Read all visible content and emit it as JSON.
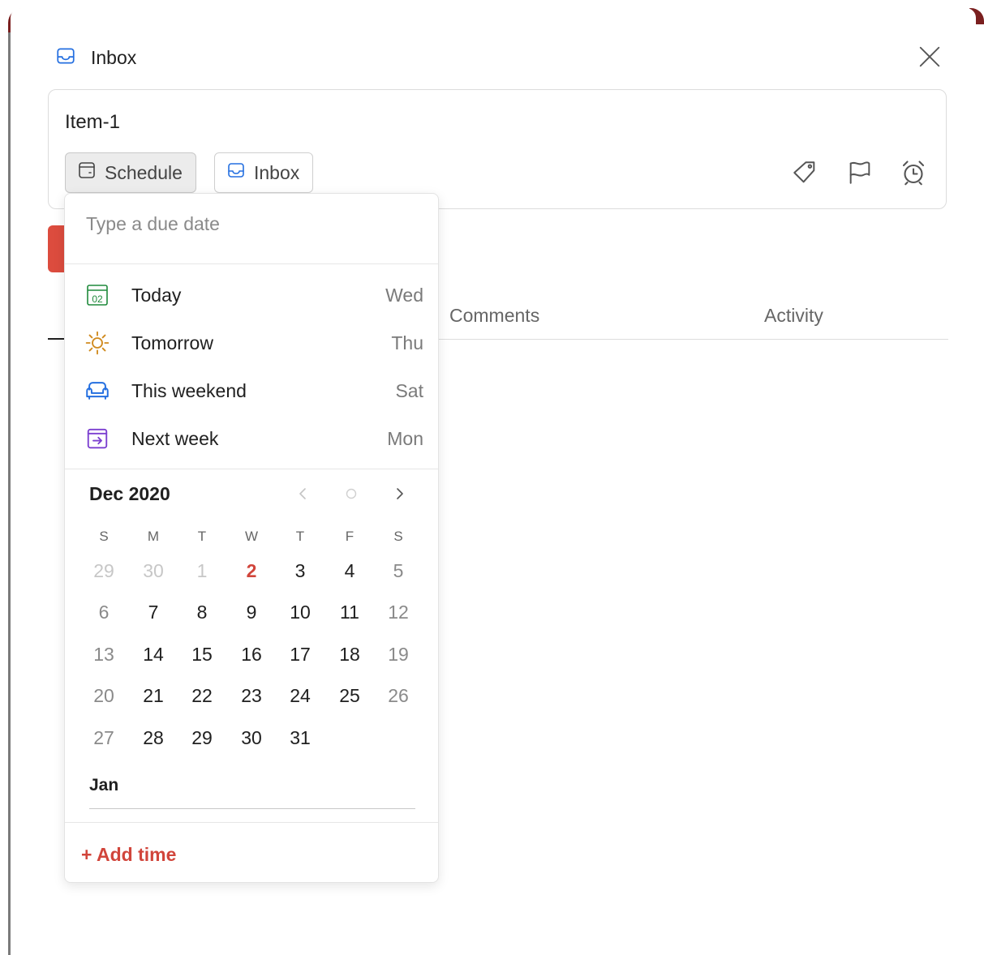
{
  "header": {
    "project": "Inbox"
  },
  "task": {
    "title": "Item-1",
    "schedule_label": "Schedule",
    "project_label": "Inbox"
  },
  "tabs": [
    {
      "label": "Comments"
    },
    {
      "label": "Activity"
    }
  ],
  "due_picker": {
    "placeholder": "Type a due date",
    "quick_options": [
      {
        "label": "Today",
        "day": "Wed",
        "icon": "calendar-today-icon",
        "icon_text": "02",
        "color": "#1f8a3b"
      },
      {
        "label": "Tomorrow",
        "day": "Thu",
        "icon": "sun-icon",
        "color": "#d08a1e"
      },
      {
        "label": "This weekend",
        "day": "Sat",
        "icon": "sofa-icon",
        "color": "#246fe0"
      },
      {
        "label": "Next week",
        "day": "Mon",
        "icon": "arrow-box-icon",
        "color": "#7b3fd0"
      }
    ],
    "calendar": {
      "month_label": "Dec 2020",
      "weekdays": [
        "S",
        "M",
        "T",
        "W",
        "T",
        "F",
        "S"
      ],
      "weeks": [
        [
          "29",
          "30",
          "1",
          "2",
          "3",
          "4",
          "5"
        ],
        [
          "6",
          "7",
          "8",
          "9",
          "10",
          "11",
          "12"
        ],
        [
          "13",
          "14",
          "15",
          "16",
          "17",
          "18",
          "19"
        ],
        [
          "20",
          "21",
          "22",
          "23",
          "24",
          "25",
          "26"
        ],
        [
          "27",
          "28",
          "29",
          "30",
          "31",
          "",
          ""
        ]
      ],
      "today": "2",
      "next_month_label": "Jan"
    },
    "add_time_label": "+ Add time"
  },
  "colors": {
    "accent_red": "#d1453b",
    "inbox_blue": "#246fe0"
  }
}
